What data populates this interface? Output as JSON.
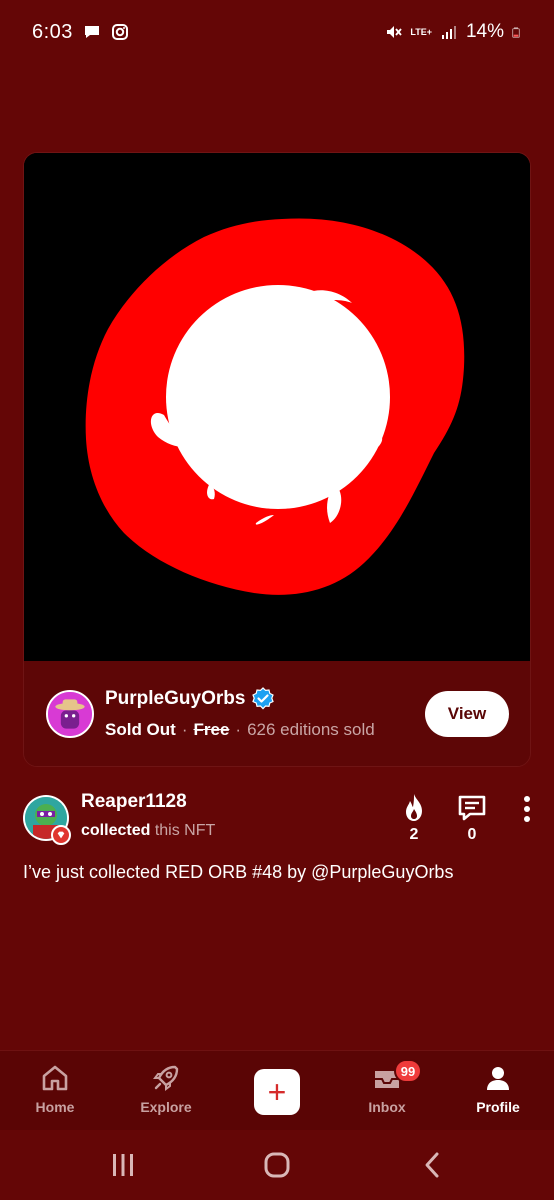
{
  "status_bar": {
    "time": "6:03",
    "network": "LTE+",
    "battery": "14%",
    "icons": [
      "chat-notification-icon",
      "instagram-icon",
      "mute-icon",
      "signal-icon",
      "battery-icon"
    ]
  },
  "nft_card": {
    "creator_name": "PurpleGuyOrbs",
    "sold_out_label": "Sold Out",
    "separator": "·",
    "price_label": "Free",
    "editions_label": "626 editions sold",
    "view_label": "View",
    "colors": {
      "art_background": "#000000",
      "orb_outer": "#ff0000",
      "orb_inner": "#ffffff"
    }
  },
  "post": {
    "username": "Reaper1128",
    "action_verb": "collected",
    "action_object": "this NFT",
    "fire_count": "2",
    "comment_count": "0",
    "text": "I’ve just collected RED ORB #48 by @PurpleGuyOrbs"
  },
  "bottom_nav": {
    "items": [
      {
        "label": "Home",
        "icon": "home-icon"
      },
      {
        "label": "Explore",
        "icon": "rocket-icon"
      },
      {
        "label": "",
        "icon": "plus-icon"
      },
      {
        "label": "Inbox",
        "icon": "inbox-icon",
        "badge": "99"
      },
      {
        "label": "Profile",
        "icon": "person-icon",
        "active": true
      }
    ]
  },
  "theme": {
    "background": "#640606",
    "accent": "#ef3b3b",
    "verified": "#1da1f2"
  }
}
